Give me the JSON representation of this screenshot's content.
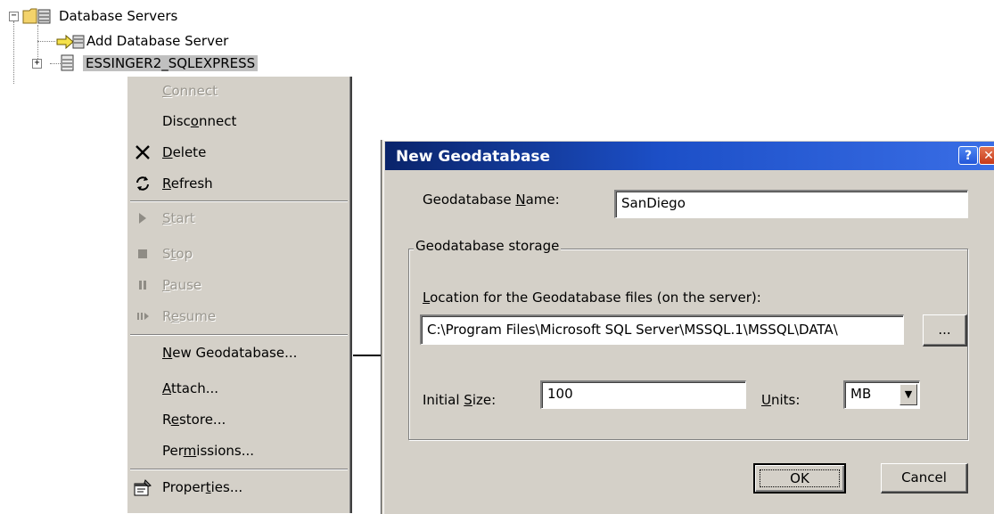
{
  "tree": {
    "root_label": "Database Servers",
    "add_server_label": "Add Database Server",
    "server_label": "ESSINGER2_SQLEXPRESS"
  },
  "context_menu": {
    "items": [
      {
        "label": "Connect",
        "accel": "C",
        "icon": "",
        "disabled": true
      },
      {
        "label": "Disconnect",
        "icon": "",
        "disabled": false
      },
      {
        "label": "Delete",
        "icon": "delete-x-icon",
        "disabled": false
      },
      {
        "label": "Refresh",
        "icon": "refresh-icon",
        "disabled": false
      },
      {
        "label": "Start",
        "icon": "play-icon",
        "disabled": true
      },
      {
        "label": "Stop",
        "icon": "stop-icon",
        "disabled": true
      },
      {
        "label": "Pause",
        "icon": "pause-icon",
        "disabled": true
      },
      {
        "label": "Resume",
        "icon": "resume-icon",
        "disabled": true
      },
      {
        "label": "New Geodatabase...",
        "icon": "",
        "disabled": false
      },
      {
        "label": "Attach...",
        "icon": "",
        "disabled": false
      },
      {
        "label": "Restore...",
        "icon": "",
        "disabled": false
      },
      {
        "label": "Permissions...",
        "icon": "",
        "disabled": false
      },
      {
        "label": "Properties...",
        "icon": "properties-icon",
        "disabled": false
      }
    ]
  },
  "dialog": {
    "title": "New Geodatabase",
    "help_glyph": "?",
    "close_glyph": "✕",
    "name_label": "Geodatabase Name:",
    "name_value": "SanDiego",
    "storage_group": "Geodatabase storage",
    "location_label": "Location for the Geodatabase files (on the server):",
    "location_value": "C:\\Program Files\\Microsoft SQL Server\\MSSQL.1\\MSSQL\\DATA\\",
    "browse_label": "...",
    "size_label": "Initial Size:",
    "size_value": "100",
    "units_label": "Units:",
    "units_value": "MB",
    "ok_label": "OK",
    "cancel_label": "Cancel"
  },
  "colors": {
    "menu_bg": "#d4d0c8",
    "title_bar": "#0a246a",
    "disabled_text": "#9a978f"
  }
}
